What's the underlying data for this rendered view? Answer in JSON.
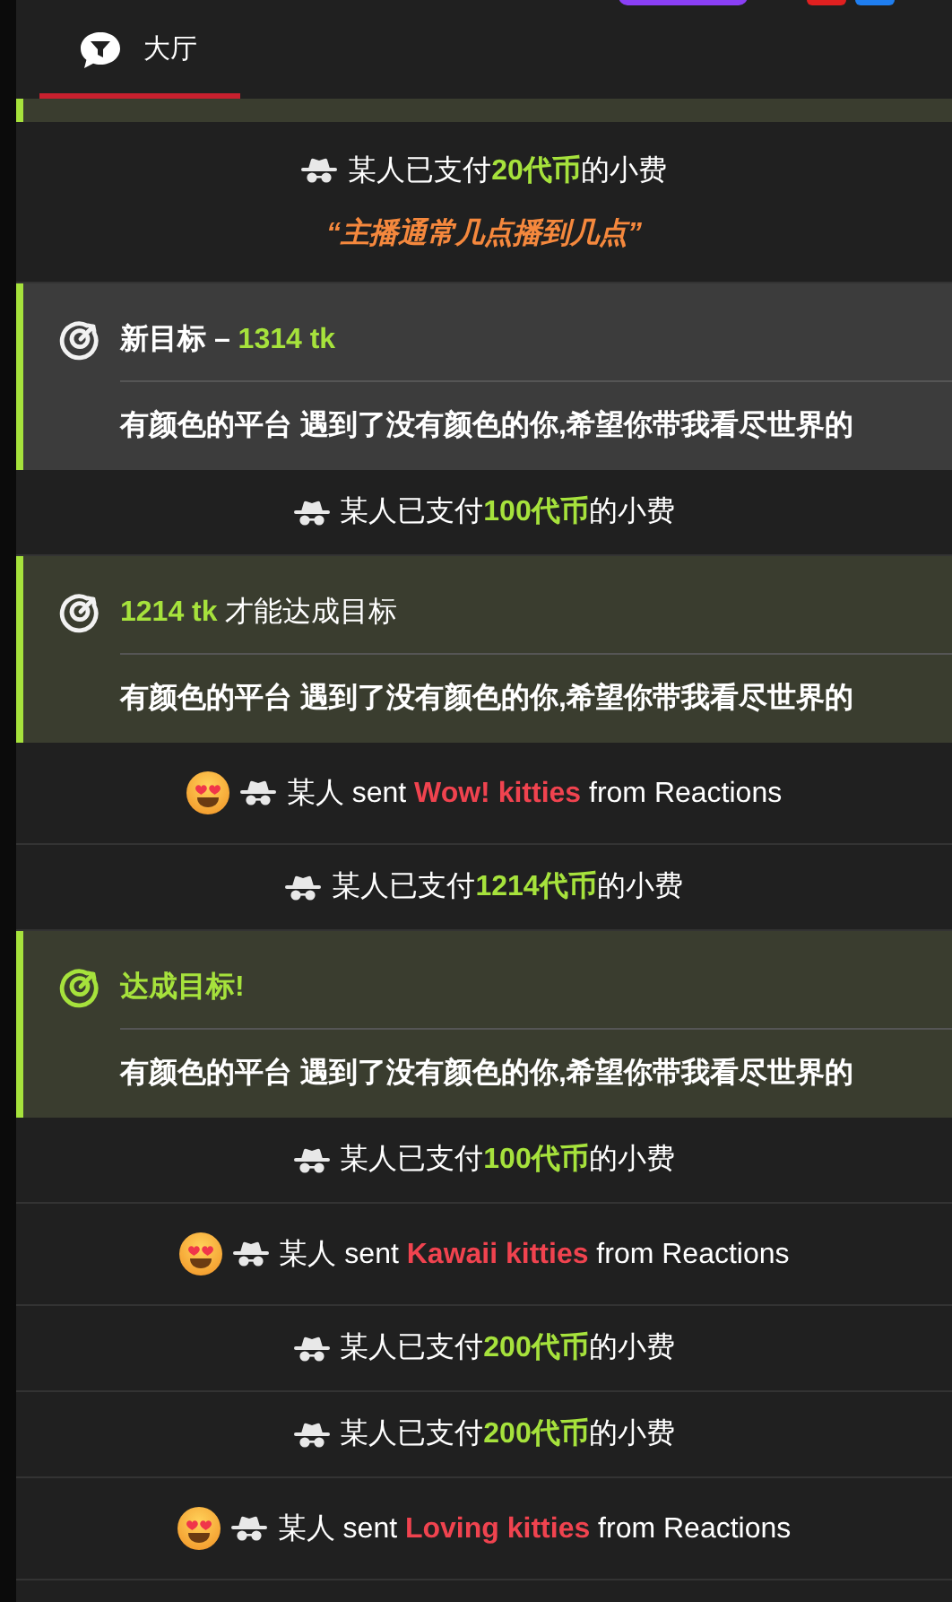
{
  "tabs": [
    {
      "label": "大厅",
      "selected": true
    }
  ],
  "feed": [
    {
      "kind": "goal_edge"
    },
    {
      "kind": "tip",
      "user": "某人",
      "text_before": "已支付",
      "amount": "20代币",
      "text_after": "的小费",
      "message": "“主播通常几点播到几点”"
    },
    {
      "kind": "newgoal",
      "headline": [
        {
          "text": "新目标 – ",
          "accent": false
        },
        {
          "text": "1314 tk",
          "accent": true
        }
      ],
      "message": "有颜色的平台 遇到了没有颜色的你,希望你带我看尽世界的"
    },
    {
      "kind": "tip",
      "user": "某人",
      "text_before": "已支付",
      "amount": "100代币",
      "text_after": "的小费"
    },
    {
      "kind": "progress",
      "headline": [
        {
          "text": "1214 tk",
          "accent": true
        },
        {
          "text": " 才能达成目标",
          "accent": false
        }
      ],
      "message": "有颜色的平台 遇到了没有颜色的你,希望你带我看尽世界的"
    },
    {
      "kind": "reaction",
      "user": "某人",
      "verb": "sent",
      "gift": "Wow! kitties",
      "source": "from Reactions"
    },
    {
      "kind": "tip",
      "user": "某人",
      "text_before": "已支付",
      "amount": "1214代币",
      "text_after": "的小费"
    },
    {
      "kind": "reached",
      "headline": [
        {
          "text": "达成目标!",
          "accent": true
        }
      ],
      "message": "有颜色的平台 遇到了没有颜色的你,希望你带我看尽世界的"
    },
    {
      "kind": "tip",
      "user": "某人",
      "text_before": "已支付",
      "amount": "100代币",
      "text_after": "的小费"
    },
    {
      "kind": "reaction",
      "user": "某人",
      "verb": "sent",
      "gift": "Kawaii kitties",
      "source": "from Reactions"
    },
    {
      "kind": "tip",
      "user": "某人",
      "text_before": "已支付",
      "amount": "200代币",
      "text_after": "的小费"
    },
    {
      "kind": "tip",
      "user": "某人",
      "text_before": "已支付",
      "amount": "200代币",
      "text_after": "的小费"
    },
    {
      "kind": "reaction",
      "user": "某人",
      "verb": "sent",
      "gift": "Loving kitties",
      "source": "from Reactions"
    }
  ]
}
